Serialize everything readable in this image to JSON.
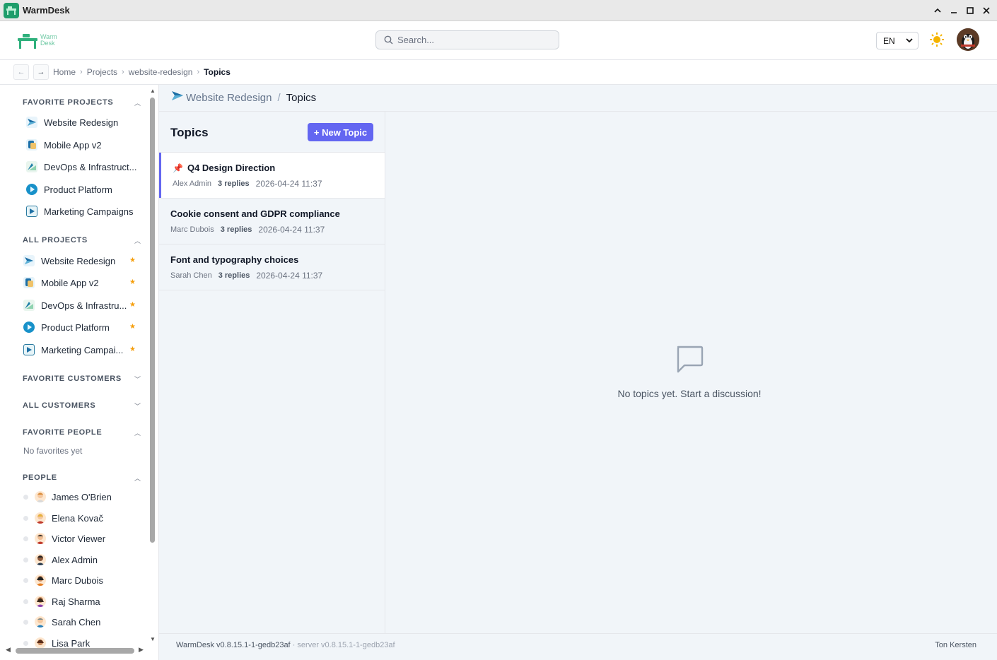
{
  "window": {
    "title": "WarmDesk"
  },
  "header": {
    "logo_line1": "Warm",
    "logo_line2": "Desk",
    "search_placeholder": "Search...",
    "language": "EN"
  },
  "breadcrumb": {
    "back": "←",
    "forward": "→",
    "items": [
      "Home",
      "Projects",
      "website-redesign"
    ],
    "current": "Topics"
  },
  "sidebar": {
    "favorite_projects_title": "FAVORITE PROJECTS",
    "favorite_projects": [
      {
        "label": "Website Redesign"
      },
      {
        "label": "Mobile App v2"
      },
      {
        "label": "DevOps & Infrastruct..."
      },
      {
        "label": "Product Platform"
      },
      {
        "label": "Marketing Campaigns"
      }
    ],
    "all_projects_title": "ALL PROJECTS",
    "all_projects": [
      {
        "label": "Website Redesign",
        "star": "★"
      },
      {
        "label": "Mobile App v2",
        "star": "★"
      },
      {
        "label": "DevOps & Infrastru...",
        "star": "★"
      },
      {
        "label": "Product Platform",
        "star": "★"
      },
      {
        "label": "Marketing Campai...",
        "star": "★"
      }
    ],
    "favorite_customers_title": "FAVORITE CUSTOMERS",
    "all_customers_title": "ALL CUSTOMERS",
    "favorite_people_title": "FAVORITE PEOPLE",
    "favorite_people_empty": "No favorites yet",
    "people_title": "PEOPLE",
    "people": [
      {
        "name": "James O'Brien"
      },
      {
        "name": "Elena Kovač"
      },
      {
        "name": "Victor Viewer"
      },
      {
        "name": "Alex Admin"
      },
      {
        "name": "Marc Dubois"
      },
      {
        "name": "Raj Sharma"
      },
      {
        "name": "Sarah Chen"
      },
      {
        "name": "Lisa Park"
      }
    ]
  },
  "main": {
    "project_name": "Website Redesign",
    "separator": "/",
    "section_title": "Topics",
    "topics_heading": "Topics",
    "new_topic_label": "+ New Topic",
    "topics": [
      {
        "title": "Q4 Design Direction",
        "author": "Alex Admin",
        "replies": "3 replies",
        "date": "2026-04-24 11:37",
        "pinned": true
      },
      {
        "title": "Cookie consent and GDPR compliance",
        "author": "Marc Dubois",
        "replies": "3 replies",
        "date": "2026-04-24 11:37",
        "pinned": false
      },
      {
        "title": "Font and typography choices",
        "author": "Sarah Chen",
        "replies": "3 replies",
        "date": "2026-04-24 11:37",
        "pinned": false
      }
    ],
    "empty_message": "No topics yet. Start a discussion!"
  },
  "footer": {
    "client_version": "WarmDesk v0.8.15.1-1-gedb23af",
    "server_version": "· server v0.8.15.1-1-gedb23af",
    "user": "Ton Kersten"
  },
  "colors": {
    "accent": "#6366f1",
    "star": "#f59e0b",
    "brand": "#1f9d6b"
  }
}
